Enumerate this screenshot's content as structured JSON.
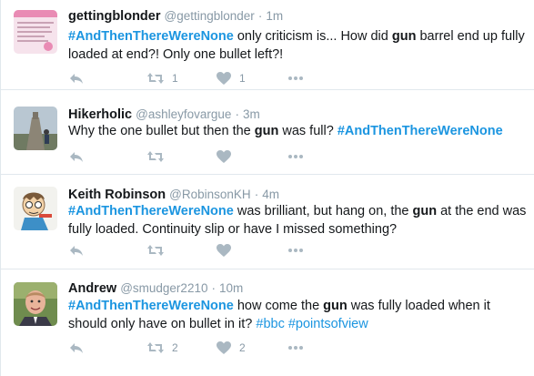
{
  "tweets": [
    {
      "name": "gettingblonder",
      "handle": "@gettingblonder",
      "dot": "·",
      "time": "1m",
      "text": [
        {
          "t": "#AndThenThereWereNone",
          "k": "bh"
        },
        {
          "t": " only criticism is... How did ",
          "k": ""
        },
        {
          "t": "gun",
          "k": "b"
        },
        {
          "t": " barrel end up fully loaded at end?! Only one bullet left?!",
          "k": ""
        }
      ],
      "retweet_count": "1",
      "like_count": "1"
    },
    {
      "name": "Hikerholic",
      "handle": "@ashleyfovargue",
      "dot": "·",
      "time": "3m",
      "text": [
        {
          "t": "Why the one bullet but then the ",
          "k": ""
        },
        {
          "t": "gun",
          "k": "b"
        },
        {
          "t": " was full? ",
          "k": ""
        },
        {
          "t": "#AndThenThereWereNone",
          "k": "bh"
        }
      ],
      "retweet_count": "",
      "like_count": ""
    },
    {
      "name": "Keith Robinson",
      "handle": "@RobinsonKH",
      "dot": "·",
      "time": "4m",
      "text": [
        {
          "t": "#AndThenThereWereNone",
          "k": "bh"
        },
        {
          "t": " was brilliant, but hang on, the ",
          "k": ""
        },
        {
          "t": "gun",
          "k": "b"
        },
        {
          "t": " at the end was fully loaded. Continuity slip or have I missed something?",
          "k": ""
        }
      ],
      "retweet_count": "",
      "like_count": ""
    },
    {
      "name": "Andrew",
      "handle": "@smudger2210",
      "dot": "·",
      "time": "10m",
      "text": [
        {
          "t": "#AndThenThereWereNone",
          "k": "bh"
        },
        {
          "t": " how come the ",
          "k": ""
        },
        {
          "t": "gun",
          "k": "b"
        },
        {
          "t": " was fully loaded when it should only have on bullet in it? ",
          "k": ""
        },
        {
          "t": "#bbc",
          "k": "h"
        },
        {
          "t": " ",
          "k": ""
        },
        {
          "t": "#pointsofview",
          "k": "h"
        }
      ],
      "retweet_count": "2",
      "like_count": "2"
    }
  ],
  "colors": {
    "hashtag": "#1b95e0",
    "icon": "#aab8c2",
    "meta": "#8899a6",
    "divider": "#e1e8ed"
  },
  "icons": [
    "reply-icon",
    "retweet-icon",
    "like-icon",
    "more-icon"
  ]
}
